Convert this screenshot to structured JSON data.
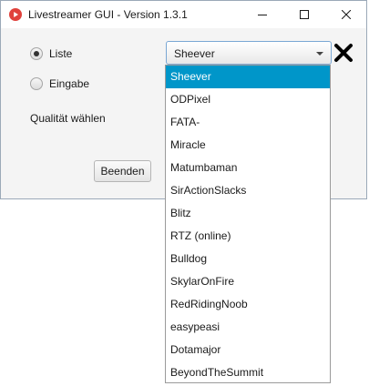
{
  "window": {
    "title": "Livestreamer GUI - Version 1.3.1",
    "controls": [
      "minimize",
      "maximize",
      "close"
    ]
  },
  "form": {
    "radio_liste": {
      "label": "Liste",
      "checked": true
    },
    "radio_eingabe": {
      "label": "Eingabe",
      "checked": false
    },
    "quality_label": "Qualität wählen",
    "exit_button": "Beenden",
    "combo": {
      "value": "Sheever"
    }
  },
  "dropdown": {
    "selected_index": 0,
    "items": [
      "Sheever",
      "ODPixel",
      "FATA-",
      "Miracle",
      "Matumbaman",
      "SirActionSlacks",
      "Blitz",
      "RTZ (online)",
      "Bulldog",
      "SkylarOnFire",
      "RedRidingNoob",
      "easypeasi",
      "Dotamajor",
      "BeyondTheSummit"
    ]
  },
  "colors": {
    "selection": "#0096c9",
    "app_icon": "#e0413b",
    "annotation_x": "#000000"
  }
}
